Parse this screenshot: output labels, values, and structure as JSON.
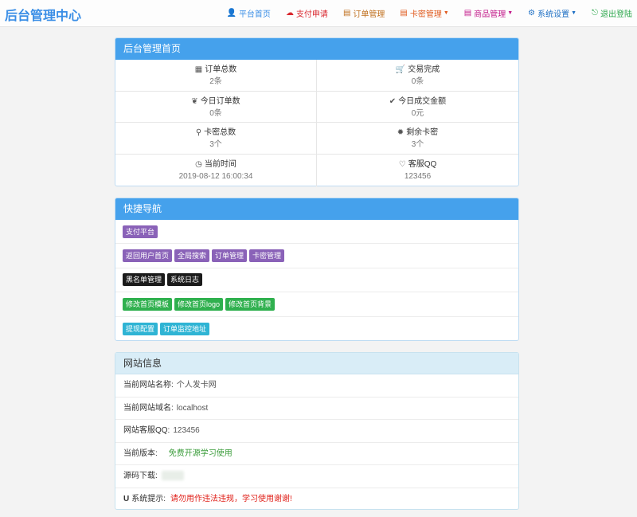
{
  "brand": "后台管理中心",
  "nav": [
    {
      "icon": "👤",
      "label": "平台首页",
      "color": "#3a8ee6",
      "caret": false
    },
    {
      "icon": "☁",
      "label": "支付申请",
      "color": "#d9272e",
      "caret": false
    },
    {
      "icon": "▤",
      "label": "订单管理",
      "color": "#c0701e",
      "caret": false
    },
    {
      "icon": "▤",
      "label": "卡密管理",
      "color": "#e05a1e",
      "caret": true
    },
    {
      "icon": "▤",
      "label": "商品管理",
      "color": "#c2198a",
      "caret": true
    },
    {
      "icon": "⚙",
      "label": "系统设置",
      "color": "#1d6fc4",
      "caret": true
    },
    {
      "icon": "⎋",
      "label": "退出登陆",
      "color": "#2aa64a",
      "caret": false
    }
  ],
  "overview": {
    "title": "后台管理首页",
    "stats": [
      {
        "icon": "▦",
        "label": "订单总数",
        "value": "2条"
      },
      {
        "icon": "🛒",
        "label": "交易完成",
        "value": "0条"
      },
      {
        "icon": "❦",
        "label": "今日订单数",
        "value": "0条"
      },
      {
        "icon": "✔",
        "label": "今日成交金额",
        "value": "0元"
      },
      {
        "icon": "⚲",
        "label": "卡密总数",
        "value": "3个"
      },
      {
        "icon": "✹",
        "label": "剩余卡密",
        "value": "3个"
      },
      {
        "icon": "◷",
        "label": "当前时间",
        "value": "2019-08-12 16:00:34"
      },
      {
        "icon": "♡",
        "label": "客服QQ",
        "value": "123456"
      }
    ]
  },
  "quicknav": {
    "title": "快捷导航",
    "rows": [
      [
        {
          "label": "支付平台",
          "style": "purple"
        }
      ],
      [
        {
          "label": "返回用户首页",
          "style": "purple"
        },
        {
          "label": "全局搜索",
          "style": "purple"
        },
        {
          "label": "订单管理",
          "style": "purple"
        },
        {
          "label": "卡密管理",
          "style": "purple"
        }
      ],
      [
        {
          "label": "黑名单管理",
          "style": "black"
        },
        {
          "label": "系统日志",
          "style": "black"
        }
      ],
      [
        {
          "label": "修改首页模板",
          "style": "green"
        },
        {
          "label": "修改首页logo",
          "style": "green"
        },
        {
          "label": "修改首页背景",
          "style": "green"
        }
      ],
      [
        {
          "label": "提现配置",
          "style": "cyan"
        },
        {
          "label": "订单监控地址",
          "style": "cyan"
        }
      ]
    ]
  },
  "siteinfo": {
    "title": "网站信息",
    "name_label": "当前网站名称:",
    "name_value": "个人发卡网",
    "domain_label": "当前网站域名:",
    "domain_value": "localhost",
    "qq_label": "网站客服QQ:",
    "qq_value": "123456",
    "version_label": "当前版本:",
    "version_value": "免费开源学习使用",
    "source_label": "源码下载:",
    "notice_icon": "U",
    "notice_label": "系统提示:",
    "notice_value": "请勿用作违法违规，学习使用谢谢!"
  }
}
